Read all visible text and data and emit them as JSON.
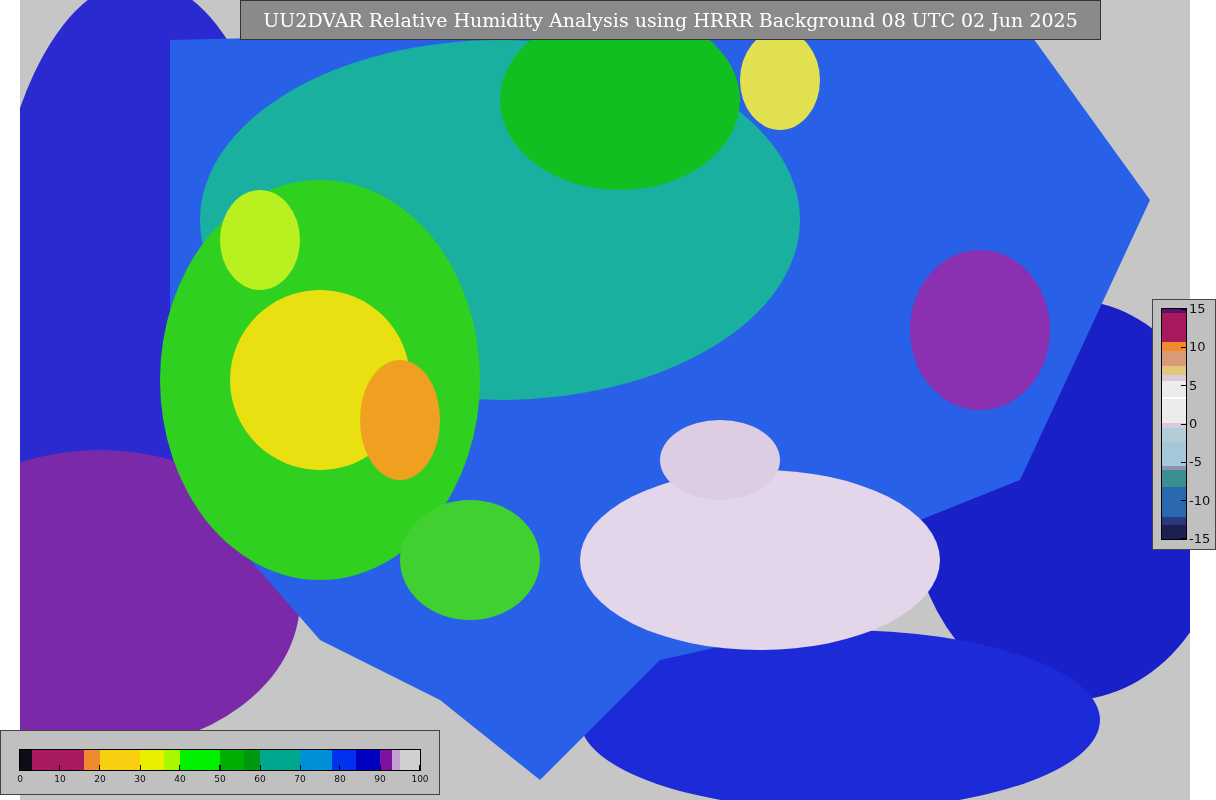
{
  "title": "UU2DVAR Relative Humidity Analysis using HRRR Background 08 UTC 02 Jun 2025",
  "main_colorbar": {
    "tick_labels": [
      "0",
      "10",
      "20",
      "30",
      "40",
      "50",
      "60",
      "70",
      "80",
      "90",
      "100"
    ]
  },
  "difference_colorbar": {
    "tick_labels": [
      "15",
      "10",
      "5",
      "0",
      "-5",
      "-10",
      "-15"
    ]
  }
}
